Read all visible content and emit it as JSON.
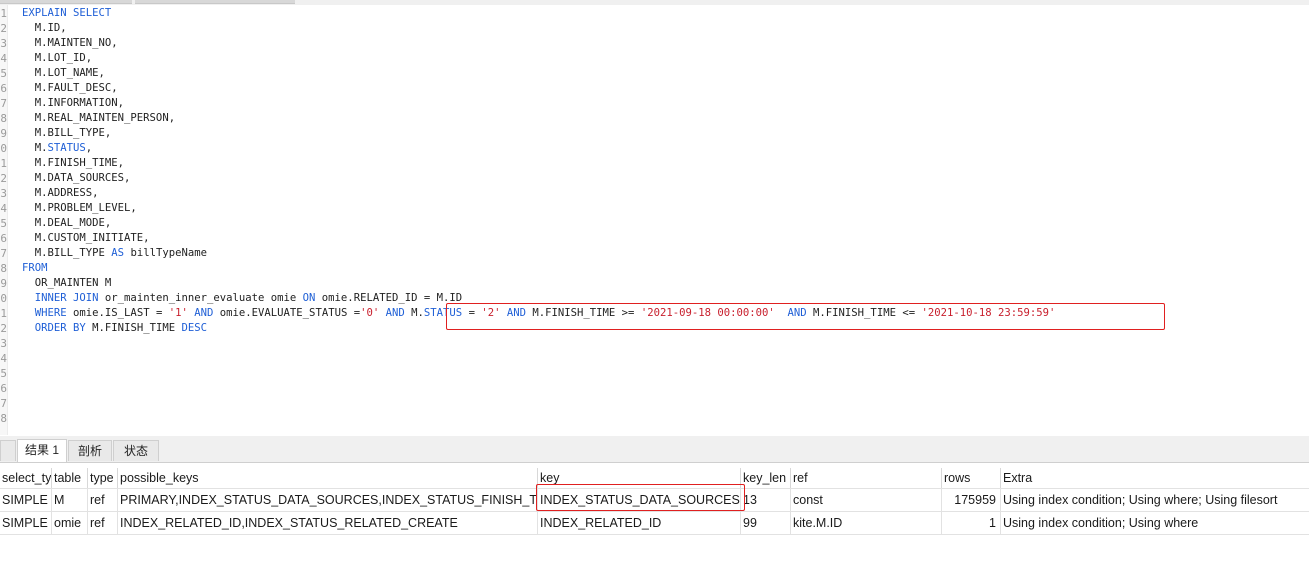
{
  "editor": {
    "lines": [
      [
        {
          "t": "EXPLAIN SELECT",
          "c": "kw"
        }
      ],
      [
        {
          "t": "  M.ID,",
          "c": "tx"
        }
      ],
      [
        {
          "t": "  M.MAINTEN_NO,",
          "c": "tx"
        }
      ],
      [
        {
          "t": "  M.LOT_ID,",
          "c": "tx"
        }
      ],
      [
        {
          "t": "  M.LOT_NAME,",
          "c": "tx"
        }
      ],
      [
        {
          "t": "  M.FAULT_DESC,",
          "c": "tx"
        }
      ],
      [
        {
          "t": "  M.INFORMATION,",
          "c": "tx"
        }
      ],
      [
        {
          "t": "  M.REAL_MAINTEN_PERSON,",
          "c": "tx"
        }
      ],
      [
        {
          "t": "  M.BILL_TYPE,",
          "c": "tx"
        }
      ],
      [
        {
          "t": "  M.",
          "c": "tx"
        },
        {
          "t": "STATUS",
          "c": "kw"
        },
        {
          "t": ",",
          "c": "tx"
        }
      ],
      [
        {
          "t": "  M.FINISH_TIME,",
          "c": "tx"
        }
      ],
      [
        {
          "t": "  M.DATA_SOURCES,",
          "c": "tx"
        }
      ],
      [
        {
          "t": "  M.ADDRESS,",
          "c": "tx"
        }
      ],
      [
        {
          "t": "  M.PROBLEM_LEVEL,",
          "c": "tx"
        }
      ],
      [
        {
          "t": "  M.DEAL_MODE,",
          "c": "tx"
        }
      ],
      [
        {
          "t": "  M.CUSTOM_INITIATE,",
          "c": "tx"
        }
      ],
      [
        {
          "t": "  M.BILL_TYPE ",
          "c": "tx"
        },
        {
          "t": "AS",
          "c": "kw"
        },
        {
          "t": " billTypeName",
          "c": "tx"
        }
      ],
      [
        {
          "t": "FROM",
          "c": "kw"
        }
      ],
      [
        {
          "t": "  OR_MAINTEN M",
          "c": "tx"
        }
      ],
      [
        {
          "t": "  ",
          "c": "tx"
        },
        {
          "t": "INNER JOIN",
          "c": "kw"
        },
        {
          "t": " or_mainten_inner_evaluate omie ",
          "c": "tx"
        },
        {
          "t": "ON",
          "c": "kw"
        },
        {
          "t": " omie.RELATED_ID = M.ID",
          "c": "tx"
        }
      ],
      [
        {
          "t": "  ",
          "c": "tx"
        },
        {
          "t": "WHERE",
          "c": "kw"
        },
        {
          "t": " omie.IS_LAST = ",
          "c": "tx"
        },
        {
          "t": "'1'",
          "c": "str"
        },
        {
          "t": " ",
          "c": "tx"
        },
        {
          "t": "AND",
          "c": "kw"
        },
        {
          "t": " omie.EVALUATE_STATUS =",
          "c": "tx"
        },
        {
          "t": "'0'",
          "c": "str"
        },
        {
          "t": " ",
          "c": "tx"
        },
        {
          "t": "AND",
          "c": "kw"
        },
        {
          "t": " M.",
          "c": "tx"
        },
        {
          "t": "STATUS",
          "c": "kw"
        },
        {
          "t": " = ",
          "c": "tx"
        },
        {
          "t": "'2'",
          "c": "str"
        },
        {
          "t": " ",
          "c": "tx"
        },
        {
          "t": "AND",
          "c": "kw"
        },
        {
          "t": " M.FINISH_TIME >= ",
          "c": "tx"
        },
        {
          "t": "'2021-09-18 00:00:00'",
          "c": "str"
        },
        {
          "t": "  ",
          "c": "tx"
        },
        {
          "t": "AND",
          "c": "kw"
        },
        {
          "t": " M.FINISH_TIME <= ",
          "c": "tx"
        },
        {
          "t": "'2021-10-18 23:59:59'",
          "c": "str"
        }
      ],
      [
        {
          "t": "  ",
          "c": "tx"
        },
        {
          "t": "ORDER BY",
          "c": "kw"
        },
        {
          "t": " M.FINISH_TIME ",
          "c": "tx"
        },
        {
          "t": "DESC",
          "c": "kw"
        }
      ]
    ]
  },
  "result_tabs": [
    {
      "label": "结果 1",
      "active": true
    },
    {
      "label": "剖析",
      "active": false
    },
    {
      "label": "状态",
      "active": false
    }
  ],
  "grid": {
    "columns": [
      "select_ty",
      "table",
      "type",
      "possible_keys",
      "key",
      "key_len",
      "ref",
      "rows",
      "Extra"
    ],
    "rows": [
      [
        "SIMPLE",
        "M",
        "ref",
        "PRIMARY,INDEX_STATUS_DATA_SOURCES,INDEX_STATUS_FINISH_TIME",
        "INDEX_STATUS_DATA_SOURCES",
        "13",
        "const",
        "175959",
        "Using index condition; Using where; Using filesort"
      ],
      [
        "SIMPLE",
        "omie",
        "ref",
        "INDEX_RELATED_ID,INDEX_STATUS_RELATED_CREATE",
        "INDEX_RELATED_ID",
        "99",
        "kite.M.ID",
        "1",
        "Using index condition; Using where"
      ]
    ]
  },
  "colors": {
    "keyword": "#1f5fd6",
    "string": "#c81e2c",
    "highlight": "#e02020"
  }
}
